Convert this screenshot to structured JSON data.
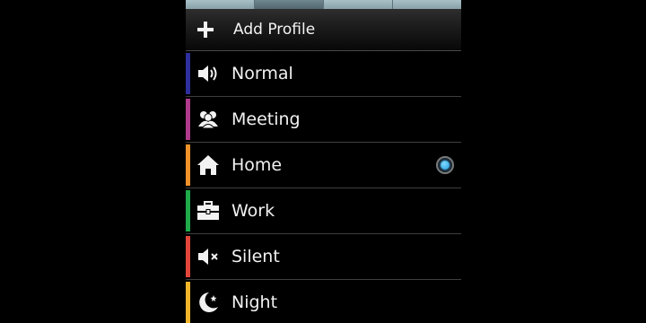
{
  "add_profile": {
    "label": "Add Profile",
    "icon": "plus-icon"
  },
  "profiles": [
    {
      "label": "Normal",
      "icon": "speaker-icon",
      "color": "#2d2f9c",
      "selected": false
    },
    {
      "label": "Meeting",
      "icon": "people-icon",
      "color": "#b03a8c",
      "selected": false
    },
    {
      "label": "Home",
      "icon": "house-icon",
      "color": "#f0922a",
      "selected": true
    },
    {
      "label": "Work",
      "icon": "briefcase-icon",
      "color": "#1faa4a",
      "selected": false
    },
    {
      "label": "Silent",
      "icon": "mute-icon",
      "color": "#e2453a",
      "selected": false
    },
    {
      "label": "Night",
      "icon": "moon-icon",
      "color": "#f2b52a",
      "selected": false
    }
  ],
  "colors": {
    "selected_radio": "#2fa8ee"
  }
}
